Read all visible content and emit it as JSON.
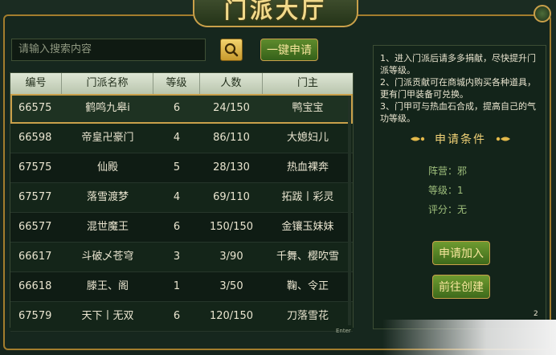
{
  "title": "门派大厅",
  "search": {
    "placeholder": "请输入搜索内容"
  },
  "apply_all_label": "一键申请",
  "table": {
    "headers": [
      "编号",
      "门派名称",
      "等级",
      "人数",
      "门主"
    ],
    "rows": [
      {
        "id": "66575",
        "name": "鹤鸣九皋i",
        "level": "6",
        "members": "24/150",
        "leader": "鸭宝宝"
      },
      {
        "id": "66598",
        "name": "帝皇卍豪门",
        "level": "4",
        "members": "86/110",
        "leader": "大媳妇儿"
      },
      {
        "id": "67575",
        "name": "仙殿",
        "level": "5",
        "members": "28/130",
        "leader": "热血裸奔"
      },
      {
        "id": "67577",
        "name": "落雪渡梦",
        "level": "4",
        "members": "69/110",
        "leader": "拓跋丨彩灵"
      },
      {
        "id": "66577",
        "name": "混世魔王",
        "level": "6",
        "members": "150/150",
        "leader": "金镶玉妹妹"
      },
      {
        "id": "66617",
        "name": "斗破乄苍穹",
        "level": "3",
        "members": "3/90",
        "leader": "千舞、樱吹雪"
      },
      {
        "id": "66618",
        "name": "滕王、阁",
        "level": "1",
        "members": "3/50",
        "leader": "鞠、令正"
      },
      {
        "id": "67579",
        "name": "天下丨无双",
        "level": "6",
        "members": "120/150",
        "leader": "刀落雪花"
      }
    ],
    "selected_index": 0,
    "footnote": "Enter"
  },
  "notes": [
    "1、进入门派后请多多捐献，尽快提升门派等级。",
    "2、门派贡献可在商城内购买各种道具，更有门甲装备可兑换。",
    "3、门甲可与热血石合成，提高自己的气功等级。"
  ],
  "conditions": {
    "title": "申请条件",
    "items": [
      "阵营：邪",
      "等级：1",
      "评分：无"
    ]
  },
  "buttons": {
    "join": "申请加入",
    "create": "前往创建"
  },
  "page_number": "2",
  "colors": {
    "gold": "#c9a04a",
    "green_button": "#4f7d22",
    "panel_bg": "#13241a"
  }
}
